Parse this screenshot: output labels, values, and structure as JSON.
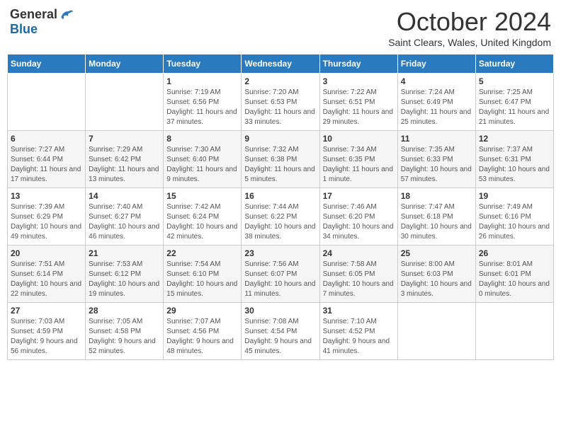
{
  "logo": {
    "general": "General",
    "blue": "Blue"
  },
  "title": "October 2024",
  "subtitle": "Saint Clears, Wales, United Kingdom",
  "days_of_week": [
    "Sunday",
    "Monday",
    "Tuesday",
    "Wednesday",
    "Thursday",
    "Friday",
    "Saturday"
  ],
  "weeks": [
    [
      {
        "day": "",
        "info": ""
      },
      {
        "day": "",
        "info": ""
      },
      {
        "day": "1",
        "info": "Sunrise: 7:19 AM\nSunset: 6:56 PM\nDaylight: 11 hours and 37 minutes."
      },
      {
        "day": "2",
        "info": "Sunrise: 7:20 AM\nSunset: 6:53 PM\nDaylight: 11 hours and 33 minutes."
      },
      {
        "day": "3",
        "info": "Sunrise: 7:22 AM\nSunset: 6:51 PM\nDaylight: 11 hours and 29 minutes."
      },
      {
        "day": "4",
        "info": "Sunrise: 7:24 AM\nSunset: 6:49 PM\nDaylight: 11 hours and 25 minutes."
      },
      {
        "day": "5",
        "info": "Sunrise: 7:25 AM\nSunset: 6:47 PM\nDaylight: 11 hours and 21 minutes."
      }
    ],
    [
      {
        "day": "6",
        "info": "Sunrise: 7:27 AM\nSunset: 6:44 PM\nDaylight: 11 hours and 17 minutes."
      },
      {
        "day": "7",
        "info": "Sunrise: 7:29 AM\nSunset: 6:42 PM\nDaylight: 11 hours and 13 minutes."
      },
      {
        "day": "8",
        "info": "Sunrise: 7:30 AM\nSunset: 6:40 PM\nDaylight: 11 hours and 9 minutes."
      },
      {
        "day": "9",
        "info": "Sunrise: 7:32 AM\nSunset: 6:38 PM\nDaylight: 11 hours and 5 minutes."
      },
      {
        "day": "10",
        "info": "Sunrise: 7:34 AM\nSunset: 6:35 PM\nDaylight: 11 hours and 1 minute."
      },
      {
        "day": "11",
        "info": "Sunrise: 7:35 AM\nSunset: 6:33 PM\nDaylight: 10 hours and 57 minutes."
      },
      {
        "day": "12",
        "info": "Sunrise: 7:37 AM\nSunset: 6:31 PM\nDaylight: 10 hours and 53 minutes."
      }
    ],
    [
      {
        "day": "13",
        "info": "Sunrise: 7:39 AM\nSunset: 6:29 PM\nDaylight: 10 hours and 49 minutes."
      },
      {
        "day": "14",
        "info": "Sunrise: 7:40 AM\nSunset: 6:27 PM\nDaylight: 10 hours and 46 minutes."
      },
      {
        "day": "15",
        "info": "Sunrise: 7:42 AM\nSunset: 6:24 PM\nDaylight: 10 hours and 42 minutes."
      },
      {
        "day": "16",
        "info": "Sunrise: 7:44 AM\nSunset: 6:22 PM\nDaylight: 10 hours and 38 minutes."
      },
      {
        "day": "17",
        "info": "Sunrise: 7:46 AM\nSunset: 6:20 PM\nDaylight: 10 hours and 34 minutes."
      },
      {
        "day": "18",
        "info": "Sunrise: 7:47 AM\nSunset: 6:18 PM\nDaylight: 10 hours and 30 minutes."
      },
      {
        "day": "19",
        "info": "Sunrise: 7:49 AM\nSunset: 6:16 PM\nDaylight: 10 hours and 26 minutes."
      }
    ],
    [
      {
        "day": "20",
        "info": "Sunrise: 7:51 AM\nSunset: 6:14 PM\nDaylight: 10 hours and 22 minutes."
      },
      {
        "day": "21",
        "info": "Sunrise: 7:53 AM\nSunset: 6:12 PM\nDaylight: 10 hours and 19 minutes."
      },
      {
        "day": "22",
        "info": "Sunrise: 7:54 AM\nSunset: 6:10 PM\nDaylight: 10 hours and 15 minutes."
      },
      {
        "day": "23",
        "info": "Sunrise: 7:56 AM\nSunset: 6:07 PM\nDaylight: 10 hours and 11 minutes."
      },
      {
        "day": "24",
        "info": "Sunrise: 7:58 AM\nSunset: 6:05 PM\nDaylight: 10 hours and 7 minutes."
      },
      {
        "day": "25",
        "info": "Sunrise: 8:00 AM\nSunset: 6:03 PM\nDaylight: 10 hours and 3 minutes."
      },
      {
        "day": "26",
        "info": "Sunrise: 8:01 AM\nSunset: 6:01 PM\nDaylight: 10 hours and 0 minutes."
      }
    ],
    [
      {
        "day": "27",
        "info": "Sunrise: 7:03 AM\nSunset: 4:59 PM\nDaylight: 9 hours and 56 minutes."
      },
      {
        "day": "28",
        "info": "Sunrise: 7:05 AM\nSunset: 4:58 PM\nDaylight: 9 hours and 52 minutes."
      },
      {
        "day": "29",
        "info": "Sunrise: 7:07 AM\nSunset: 4:56 PM\nDaylight: 9 hours and 48 minutes."
      },
      {
        "day": "30",
        "info": "Sunrise: 7:08 AM\nSunset: 4:54 PM\nDaylight: 9 hours and 45 minutes."
      },
      {
        "day": "31",
        "info": "Sunrise: 7:10 AM\nSunset: 4:52 PM\nDaylight: 9 hours and 41 minutes."
      },
      {
        "day": "",
        "info": ""
      },
      {
        "day": "",
        "info": ""
      }
    ]
  ]
}
